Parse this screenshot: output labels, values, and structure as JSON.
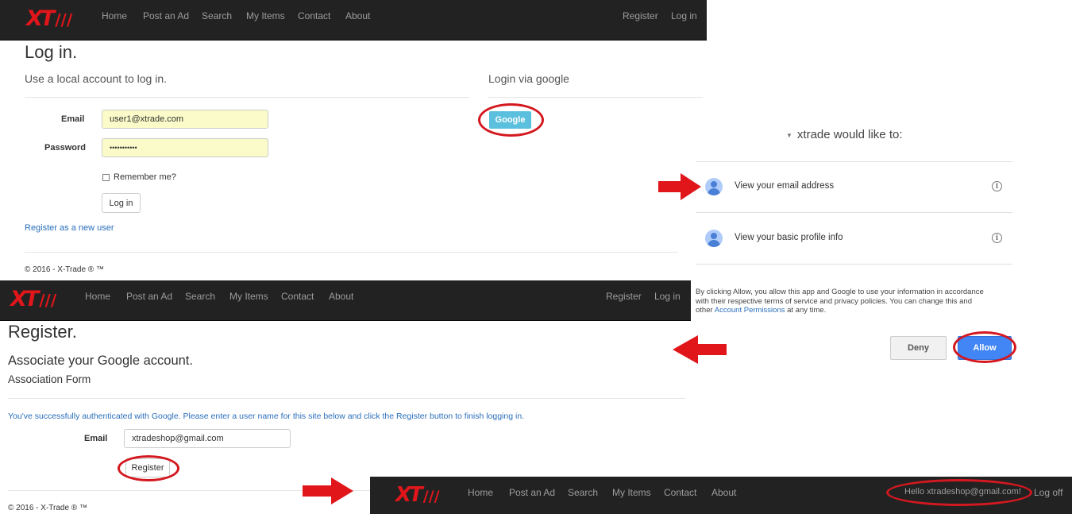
{
  "nav": {
    "logo": "XT",
    "items": [
      "Home",
      "Post an Ad",
      "Search",
      "My Items",
      "Contact",
      "About"
    ],
    "register": "Register",
    "login": "Log in",
    "hello": "Hello xtradeshop@gmail.com!",
    "logoff": "Log off"
  },
  "login_page": {
    "title": "Log in.",
    "local_heading": "Use a local account to log in.",
    "email_label": "Email",
    "email_value": "user1@xtrade.com",
    "password_label": "Password",
    "password_value": "•••••••••••",
    "remember_label": "Remember me?",
    "login_button": "Log in",
    "register_link": "Register as a new user",
    "external_heading": "Login via google",
    "google_button": "Google",
    "footer": "© 2016 - X-Trade ® ™"
  },
  "consent": {
    "title": "xtrade would like to:",
    "permissions": [
      "View your email address",
      "View your basic profile info"
    ],
    "notice_line1": "By clicking Allow, you allow this app and Google to use your information in accordance",
    "notice_line2": "with their respective terms of service and privacy policies. You can change this and",
    "notice_line3_pre": "other ",
    "notice_link": "Account Permissions",
    "notice_line3_post": " at any time.",
    "deny": "Deny",
    "allow": "Allow"
  },
  "register_page": {
    "title": "Register.",
    "subtitle": "Associate your Google account.",
    "form_title": "Association Form",
    "message_pre": "You've successfully authenticated with ",
    "message_provider": "Google",
    "message_post": ". Please enter a user name for this site below and click the Register button to finish logging in.",
    "email_label": "Email",
    "email_value": "xtradeshop@gmail.com",
    "register_button": "Register",
    "footer": "© 2016 - X-Trade ® ™"
  },
  "colors": {
    "navbar": "#222222",
    "nav_text": "#9d9d9d",
    "logo_red": "#e0161b",
    "highlight_red": "#d41820",
    "google_button": "#5bc0de",
    "allow_button": "#4285f4",
    "link": "#2a6ebb"
  }
}
